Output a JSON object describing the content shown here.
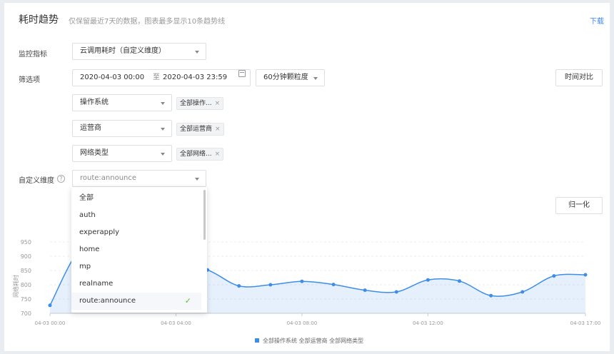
{
  "header": {
    "title": "耗时趋势",
    "subtitle": "仅保留最近7天的数据，图表最多显示10条趋势线",
    "download": "下载"
  },
  "filters": {
    "metric_label": "监控指标",
    "metric_value": "云调用耗时（自定义维度）",
    "filter_label": "筛选项",
    "date_start": "2020-04-03 00:00",
    "date_to": "至",
    "date_end": "2020-04-03 23:59",
    "granularity": "60分钟颗粒度",
    "compare_button": "时间对比",
    "os_select": "操作系统",
    "os_tag": "全部操作...",
    "carrier_select": "运营商",
    "carrier_tag": "全部运营商",
    "network_select": "网络类型",
    "network_tag": "全部网络...",
    "custom_label": "自定义维度",
    "custom_placeholder": "route:announce"
  },
  "dropdown": {
    "items": [
      "全部",
      "auth",
      "experapply",
      "home",
      "mp",
      "realname",
      "route:announce"
    ],
    "selected_index": 6
  },
  "normalize_button": "归一化",
  "chart_data": {
    "type": "area",
    "x": [
      "04-03 00:00",
      "04-03 01:00",
      "04-03 02:00",
      "04-03 03:00",
      "04-03 04:00",
      "04-03 05:00",
      "04-03 06:00",
      "04-03 07:00",
      "04-03 08:00",
      "04-03 09:00",
      "04-03 10:00",
      "04-03 11:00",
      "04-03 12:00",
      "04-03 13:00",
      "04-03 14:00",
      "04-03 15:00",
      "04-03 16:00",
      "04-03 17:00"
    ],
    "x_ticks": [
      "04-03 00:00",
      "04-03 04:00",
      "04-03 08:00",
      "04-03 12:00",
      "04-03 17:00"
    ],
    "series": [
      {
        "name": "全部操作系统 全部运营商 全部网络类型",
        "values": [
          728,
          930,
          915,
          890,
          870,
          852,
          796,
          800,
          812,
          801,
          781,
          775,
          817,
          813,
          762,
          775,
          831,
          835
        ]
      }
    ],
    "ylabel": "网络耗时",
    "ylim": [
      700,
      950
    ],
    "yticks": [
      700,
      750,
      800,
      850,
      900,
      950
    ],
    "grid": true,
    "legend_position": "bottom",
    "color": "#3d8ee8"
  }
}
